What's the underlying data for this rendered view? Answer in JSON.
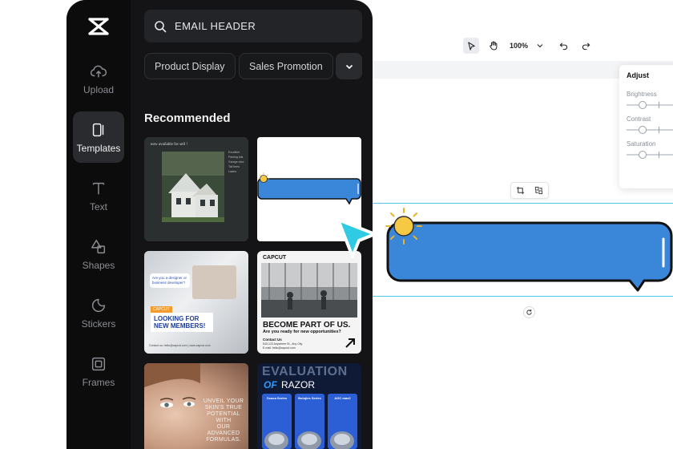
{
  "toolbar": {
    "zoom_label": "100%"
  },
  "adjust_panel": {
    "title": "Adjust",
    "rows": [
      {
        "label": "Brightness"
      },
      {
        "label": "Contrast"
      },
      {
        "label": "Saturation"
      }
    ]
  },
  "sidebar": {
    "items": [
      {
        "label": "Upload",
        "icon": "upload-cloud-icon"
      },
      {
        "label": "Templates",
        "icon": "templates-icon"
      },
      {
        "label": "Text",
        "icon": "text-icon"
      },
      {
        "label": "Shapes",
        "icon": "shapes-icon"
      },
      {
        "label": "Stickers",
        "icon": "stickers-icon"
      },
      {
        "label": "Frames",
        "icon": "frames-icon"
      }
    ]
  },
  "search": {
    "value": "EMAIL HEADER"
  },
  "chips": [
    "Product Display",
    "Sales Promotion"
  ],
  "section": {
    "title": "Recommended"
  },
  "templates": {
    "house": {
      "headline": "now available for sell !",
      "list": [
        "Excellent",
        "Parking lots",
        "Garage door",
        "Tall trees",
        "Lawns"
      ]
    },
    "recruit": {
      "bubble": "Are you a designer or business developer?",
      "brand": "CAPCUT",
      "headline1": "LOOKING FOR",
      "headline2": "NEW MEMBERS!",
      "contact": "Contact us: hello@capcut.com | www.capcut.com"
    },
    "community": {
      "brand": "CAPCUT",
      "headline": "BECOME PART OF US.",
      "subhead": "Are you ready for new opportunities?",
      "contact_title": "Contact Us",
      "contact_line1": "543-123 Anywhere St., Any City",
      "contact_line2": "E-mail: hello@capcut.com"
    },
    "beauty": {
      "lines": [
        "UNVEIL YOUR",
        "SKIN'S TRUE",
        "POTENTIAL WITH",
        "OUR ADVANCED",
        "FORMULAS."
      ]
    },
    "razor": {
      "title1": "EVALUATION",
      "title2a": "OF",
      "title2b": "RAZOR",
      "columns": [
        "Dcaca Series",
        "Bolujies Series",
        "AGC max2"
      ]
    }
  },
  "colors": {
    "accent_cyan": "#2ecbe3",
    "bubble_blue": "#3a86d8",
    "panel_dark": "#141416"
  }
}
